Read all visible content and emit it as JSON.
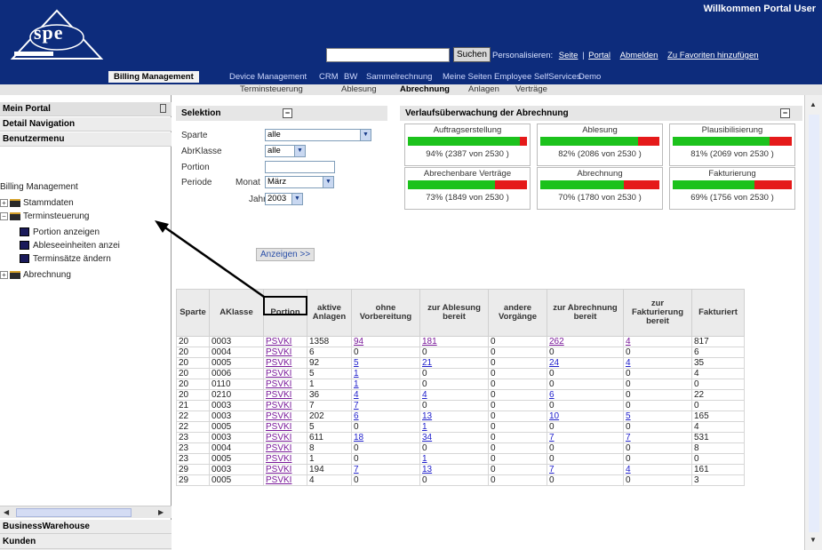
{
  "header": {
    "welcome": "Willkommen Portal User",
    "logo_text": "spe",
    "search_placeholder": "",
    "search_button": "Suchen",
    "personalize_label": "Personalisieren:",
    "links": [
      "Seite",
      "Portal",
      "Abmelden",
      "Zu Favoriten hinzufügen"
    ],
    "link_separator": "|"
  },
  "main_nav": [
    "Billing Management",
    "Device Management",
    "CRM",
    "BW",
    "Sammelrechnung",
    "Meine Seiten",
    "Employee SelfServices",
    "Demo"
  ],
  "sub_nav": [
    "Terminsteuerung",
    "Ablesung",
    "Abrechnung",
    "Anlagen",
    "Verträge"
  ],
  "left_panel": {
    "headers": [
      "Mein Portal",
      "Detail Navigation",
      "Benutzermenu"
    ],
    "tree_title": "Billing Management",
    "tree": [
      {
        "label": "Stammdaten",
        "type": "folder",
        "expander": "+"
      },
      {
        "label": "Terminsteuerung",
        "type": "folder",
        "expander": "−"
      },
      {
        "label": "Portion anzeigen",
        "type": "leaf"
      },
      {
        "label": "Ableseeinheiten anzei",
        "type": "leaf"
      },
      {
        "label": "Terminsätze ändern",
        "type": "leaf"
      },
      {
        "label": "Abrechnung",
        "type": "folder",
        "expander": "+"
      }
    ],
    "bottom_headers": [
      "BusinessWarehouse",
      "Kunden"
    ]
  },
  "selection": {
    "title": "Selektion",
    "sparte_label": "Sparte",
    "sparte_value": "alle",
    "abrklasse_label": "AbrKlasse",
    "abrklasse_value": "alle",
    "portion_label": "Portion",
    "portion_value": "",
    "periode_label": "Periode",
    "monat_label": "Monat",
    "monat_value": "März",
    "jahr_label": "Jahr",
    "jahr_value": "2003",
    "button": "Anzeigen >>"
  },
  "monitoring": {
    "title": "Verlaufsüberwachung der Abrechnung",
    "metrics": [
      {
        "label": "Auftragserstellung",
        "percent": 94,
        "text": "94% (2387 von 2530 )"
      },
      {
        "label": "Ablesung",
        "percent": 82,
        "text": "82% (2086 von 2530 )"
      },
      {
        "label": "Plausibilisierung",
        "percent": 81,
        "text": "81% (2069 von 2530 )"
      },
      {
        "label": "Abrechenbare Verträge",
        "percent": 73,
        "text": "73% (1849 von 2530 )"
      },
      {
        "label": "Abrechnung",
        "percent": 70,
        "text": "70% (1780 von 2530 )"
      },
      {
        "label": "Fakturierung",
        "percent": 69,
        "text": "69% (1756 von 2530 )"
      }
    ]
  },
  "table": {
    "headers": [
      "Sparte",
      "AKlasse",
      "Portion",
      "aktive Anlagen",
      "ohne Vorbereitung",
      "zur Ablesung bereit",
      "andere Vorgänge",
      "zur Abrechnung bereit",
      "zur Fakturierung bereit",
      "Fakturiert"
    ],
    "rows": [
      [
        "20",
        "0003",
        "PSVKI",
        "1358",
        "94",
        "181",
        "0",
        "262",
        "4",
        "817"
      ],
      [
        "20",
        "0004",
        "PSVKI",
        "6",
        "0",
        "0",
        "0",
        "0",
        "0",
        "6"
      ],
      [
        "20",
        "0005",
        "PSVKI",
        "92",
        "5",
        "21",
        "0",
        "24",
        "4",
        "35"
      ],
      [
        "20",
        "0006",
        "PSVKI",
        "5",
        "1",
        "0",
        "0",
        "0",
        "0",
        "4"
      ],
      [
        "20",
        "0110",
        "PSVKI",
        "1",
        "1",
        "0",
        "0",
        "0",
        "0",
        "0"
      ],
      [
        "20",
        "0210",
        "PSVKI",
        "36",
        "4",
        "4",
        "0",
        "6",
        "0",
        "22"
      ],
      [
        "21",
        "0003",
        "PSVKI",
        "7",
        "7",
        "0",
        "0",
        "0",
        "0",
        "0"
      ],
      [
        "22",
        "0003",
        "PSVKI",
        "202",
        "6",
        "13",
        "0",
        "10",
        "5",
        "165"
      ],
      [
        "22",
        "0005",
        "PSVKI",
        "5",
        "0",
        "1",
        "0",
        "0",
        "0",
        "4"
      ],
      [
        "23",
        "0003",
        "PSVKI",
        "611",
        "18",
        "34",
        "0",
        "7",
        "7",
        "531"
      ],
      [
        "23",
        "0004",
        "PSVKI",
        "8",
        "0",
        "0",
        "0",
        "0",
        "0",
        "8"
      ],
      [
        "23",
        "0005",
        "PSVKI",
        "1",
        "0",
        "1",
        "0",
        "0",
        "0",
        "0"
      ],
      [
        "29",
        "0003",
        "PSVKI",
        "194",
        "7",
        "13",
        "0",
        "7",
        "4",
        "161"
      ],
      [
        "29",
        "0005",
        "PSVKI",
        "4",
        "0",
        "0",
        "0",
        "0",
        "0",
        "3"
      ]
    ]
  },
  "colors": {
    "header_bg": "#0d2c7c",
    "bar_green": "#1cc21c",
    "bar_red": "#e51a1a",
    "link": "#2222cc"
  }
}
